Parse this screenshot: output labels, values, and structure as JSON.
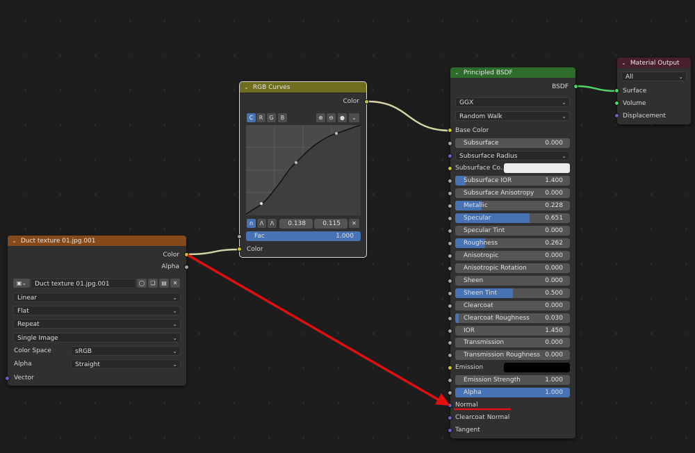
{
  "curves_node": {
    "title": "RGB Curves",
    "output_color": "Color",
    "channels": [
      "C",
      "R",
      "G",
      "B"
    ],
    "point_x": "0.138",
    "point_y": "0.115",
    "fac_label": "Fac",
    "fac_value": "1.000",
    "input_color": "Color"
  },
  "texture_node": {
    "title": "Duct texture 01.jpg.001",
    "out_color": "Color",
    "out_alpha": "Alpha",
    "image_name": "Duct texture 01.jpg.001",
    "interpolation": "Linear",
    "projection": "Flat",
    "extension": "Repeat",
    "source": "Single Image",
    "color_space_label": "Color Space",
    "color_space": "sRGB",
    "alpha_label": "Alpha",
    "alpha_mode": "Straight",
    "vector_label": "Vector"
  },
  "bsdf_node": {
    "title": "Principled BSDF",
    "output": "BSDF",
    "distribution": "GGX",
    "subsurface_method": "Random Walk",
    "base_color": "Base Color",
    "rows": [
      {
        "label": "Subsurface",
        "value": "0.000",
        "fraction": 0.0
      },
      {
        "label": "Subsurface IOR",
        "value": "1.400",
        "fraction": 0.09
      },
      {
        "label": "Subsurface Anisotropy",
        "value": "0.000",
        "fraction": 0.0
      },
      {
        "label": "Metallic",
        "value": "0.228",
        "fraction": 0.228
      },
      {
        "label": "Specular",
        "value": "0.651",
        "fraction": 0.651
      },
      {
        "label": "Specular Tint",
        "value": "0.000",
        "fraction": 0.0
      },
      {
        "label": "Roughness",
        "value": "0.262",
        "fraction": 0.262
      },
      {
        "label": "Anisotropic",
        "value": "0.000",
        "fraction": 0.0
      },
      {
        "label": "Anisotropic Rotation",
        "value": "0.000",
        "fraction": 0.0
      },
      {
        "label": "Sheen",
        "value": "0.000",
        "fraction": 0.0
      },
      {
        "label": "Sheen Tint",
        "value": "0.500",
        "fraction": 0.5
      },
      {
        "label": "Clearcoat",
        "value": "0.000",
        "fraction": 0.0
      },
      {
        "label": "Clearcoat Roughness",
        "value": "0.030",
        "fraction": 0.03
      },
      {
        "label": "IOR",
        "value": "1.450",
        "fraction": 0.0
      },
      {
        "label": "Transmission",
        "value": "0.000",
        "fraction": 0.0
      },
      {
        "label": "Transmission Roughness",
        "value": "0.000",
        "fraction": 0.0
      }
    ],
    "subsurface_radius": "Subsurface Radius",
    "subsurface_color": "Subsurface Co...",
    "emission": "Emission",
    "emission_strength": {
      "label": "Emission Strength",
      "value": "1.000",
      "fraction": 0.0
    },
    "alpha": {
      "label": "Alpha",
      "value": "1.000",
      "fraction": 1.0
    },
    "normal": "Normal",
    "clearcoat_normal": "Clearcoat Normal",
    "tangent": "Tangent"
  },
  "output_node": {
    "title": "Material Output",
    "target": "All",
    "surface": "Surface",
    "volume": "Volume",
    "displacement": "Displacement"
  },
  "colors": {
    "curves_header": "#6e6e1e",
    "texture_header": "#864a1a",
    "bsdf_header": "#2d6c2b",
    "output_header": "#4a1f2c",
    "annotation_red": "#e01010",
    "link_color": "#c9c98a"
  }
}
